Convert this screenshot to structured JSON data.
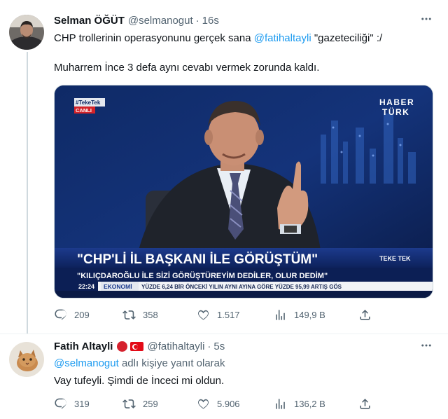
{
  "tweets": [
    {
      "author_name": "Selman ÖĞÜT",
      "handle": "@selmanogut",
      "separator": "·",
      "time": "16s",
      "text_line1_prefix": "CHP trollerinin operasyonunu gerçek sana ",
      "text_line1_mention": "@fatihaltayli",
      "text_line1_suffix": " \"gazeteciliği\" :/",
      "text_line2": "Muharrem İnce 3 defa aynı cevabı vermek zorunda kaldı.",
      "media": {
        "channel_tag": "#TekeTek",
        "live_label": "CANLI",
        "network_line1": "HABER",
        "network_line2": "TÜRK",
        "headline": "\"CHP'Lİ İL BAŞKANI İLE GÖRÜŞTÜM\"",
        "show_tag": "TEKE TEK",
        "subheadline": "\"KILIÇDAROĞLU İLE SİZİ GÖRÜŞTÜREYİM DEDİLER, OLUR DEDİM\"",
        "clock": "22:24",
        "ticker_label": "EKONOMİ",
        "ticker_text": "YÜZDE 6,24 BİR ÖNCEKİ YILIN AYNI AYINA GÖRE YÜZDE 95,99 ARTIŞ GÖS"
      },
      "reply_count": "209",
      "retweet_count": "358",
      "like_count": "1.517",
      "view_count": "149,9 B"
    },
    {
      "author_name": "Fatih Altayli",
      "handle": "@fatihaltayli",
      "separator": "·",
      "time": "5s",
      "reply_mention": "@selmanogut",
      "reply_suffix": " adlı kişiye yanıt olarak",
      "text": "Vay tufeyli. Şimdi de İnceci mi oldun.",
      "reply_count": "319",
      "retweet_count": "259",
      "like_count": "5.906",
      "view_count": "136,2 B"
    }
  ],
  "colors": {
    "accent": "#1d9bf0",
    "secondary_text": "#536471",
    "primary_text": "#0f1419",
    "border": "#cfd9de"
  },
  "icons": [
    "reply-icon",
    "retweet-icon",
    "like-icon",
    "views-icon",
    "share-icon",
    "more-icon"
  ]
}
